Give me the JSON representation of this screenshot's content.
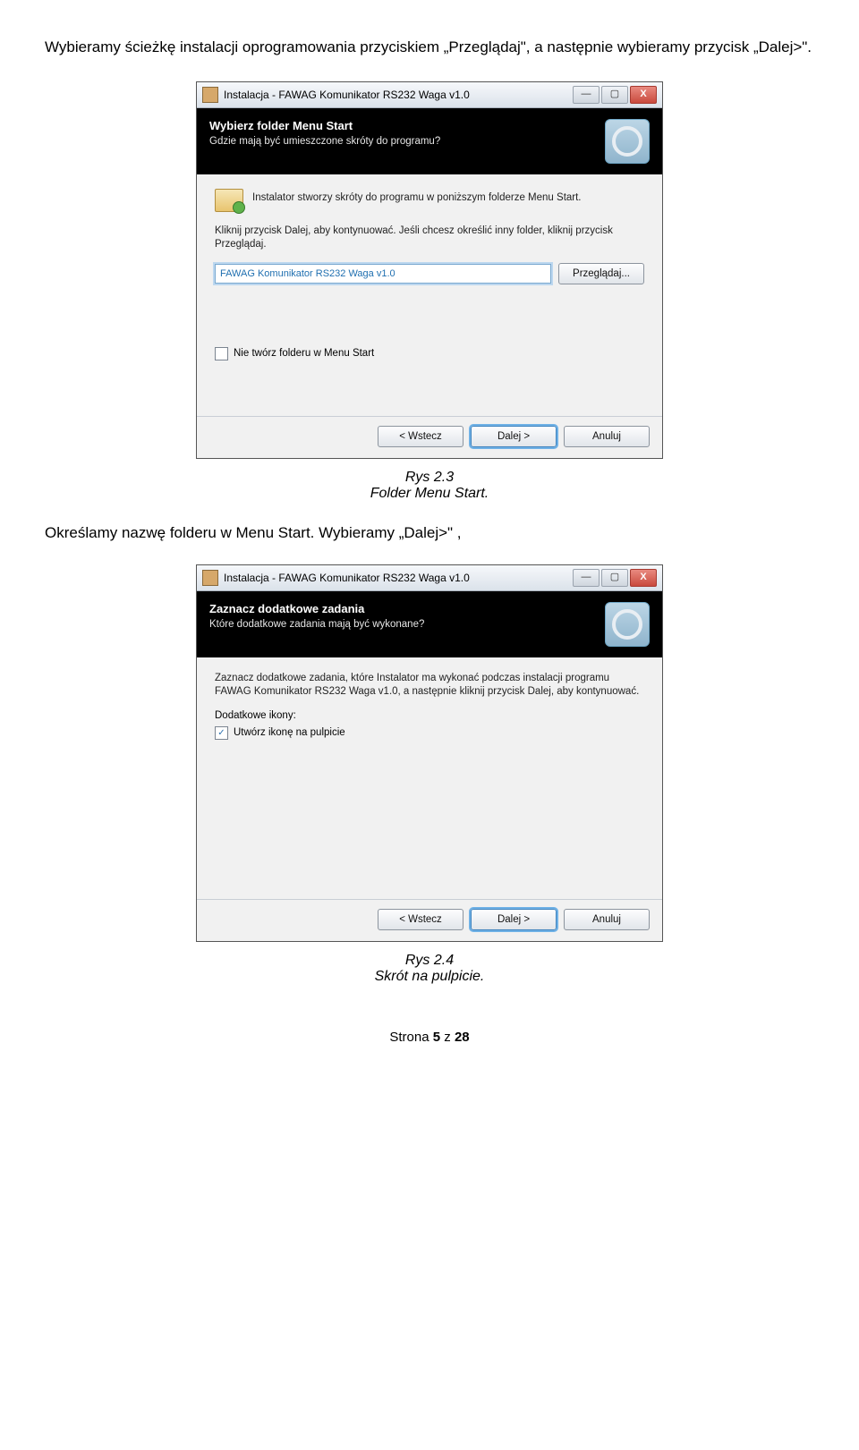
{
  "intro": "Wybieramy ścieżkę instalacji oprogramowania przyciskiem „Przeglądaj\", a następnie wybieramy przycisk „Dalej>\".",
  "shot1": {
    "title": "Instalacja - FAWAG Komunikator RS232 Waga v1.0",
    "heading": "Wybierz folder Menu Start",
    "subheading": "Gdzie mają być umieszczone skróty do programu?",
    "info": "Instalator stworzy skróty do programu w poniższym folderze Menu Start.",
    "para": "Kliknij przycisk Dalej, aby kontynuować. Jeśli chcesz określić inny folder, kliknij przycisk Przeglądaj.",
    "path": "FAWAG Komunikator RS232 Waga v1.0",
    "browse": "Przeglądaj...",
    "dont_create": "Nie twórz folderu w Menu Start",
    "back": "< Wstecz",
    "next": "Dalej >",
    "cancel": "Anuluj"
  },
  "caption1_line1": "Rys 2.3",
  "caption1_line2": "Folder Menu Start.",
  "mid": "Określamy nazwę folderu w Menu Start. Wybieramy „Dalej>\" ,",
  "shot2": {
    "title": "Instalacja - FAWAG Komunikator RS232 Waga v1.0",
    "heading": "Zaznacz dodatkowe zadania",
    "subheading": "Które dodatkowe zadania mają być wykonane?",
    "para": "Zaznacz dodatkowe zadania, które Instalator ma wykonać podczas instalacji programu FAWAG Komunikator RS232 Waga v1.0, a następnie kliknij przycisk Dalej, aby kontynuować.",
    "addl": "Dodatkowe ikony:",
    "chk_label": "Utwórz ikonę na pulpicie",
    "back": "< Wstecz",
    "next": "Dalej >",
    "cancel": "Anuluj"
  },
  "caption2_line1": "Rys 2.4",
  "caption2_line2": "Skrót na pulpicie.",
  "footer_pre": "Strona ",
  "footer_num": "5",
  "footer_mid": " z ",
  "footer_total": "28"
}
